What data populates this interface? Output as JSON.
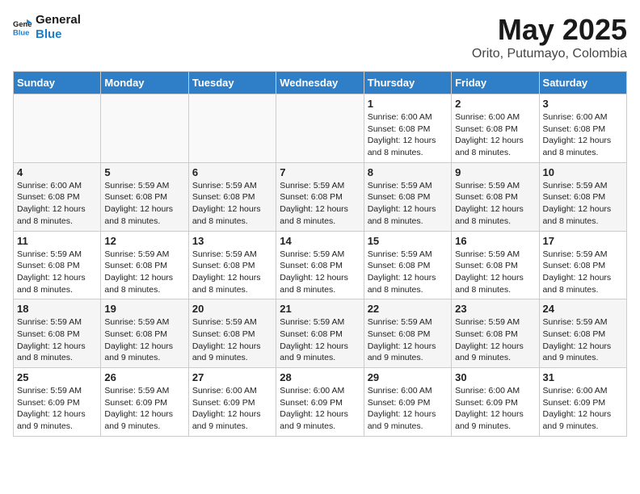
{
  "logo": {
    "line1": "General",
    "line2": "Blue"
  },
  "title": "May 2025",
  "subtitle": "Orito, Putumayo, Colombia",
  "weekdays": [
    "Sunday",
    "Monday",
    "Tuesday",
    "Wednesday",
    "Thursday",
    "Friday",
    "Saturday"
  ],
  "weeks": [
    [
      {
        "day": "",
        "info": ""
      },
      {
        "day": "",
        "info": ""
      },
      {
        "day": "",
        "info": ""
      },
      {
        "day": "",
        "info": ""
      },
      {
        "day": "1",
        "info": "Sunrise: 6:00 AM\nSunset: 6:08 PM\nDaylight: 12 hours and 8 minutes."
      },
      {
        "day": "2",
        "info": "Sunrise: 6:00 AM\nSunset: 6:08 PM\nDaylight: 12 hours and 8 minutes."
      },
      {
        "day": "3",
        "info": "Sunrise: 6:00 AM\nSunset: 6:08 PM\nDaylight: 12 hours and 8 minutes."
      }
    ],
    [
      {
        "day": "4",
        "info": "Sunrise: 6:00 AM\nSunset: 6:08 PM\nDaylight: 12 hours and 8 minutes."
      },
      {
        "day": "5",
        "info": "Sunrise: 5:59 AM\nSunset: 6:08 PM\nDaylight: 12 hours and 8 minutes."
      },
      {
        "day": "6",
        "info": "Sunrise: 5:59 AM\nSunset: 6:08 PM\nDaylight: 12 hours and 8 minutes."
      },
      {
        "day": "7",
        "info": "Sunrise: 5:59 AM\nSunset: 6:08 PM\nDaylight: 12 hours and 8 minutes."
      },
      {
        "day": "8",
        "info": "Sunrise: 5:59 AM\nSunset: 6:08 PM\nDaylight: 12 hours and 8 minutes."
      },
      {
        "day": "9",
        "info": "Sunrise: 5:59 AM\nSunset: 6:08 PM\nDaylight: 12 hours and 8 minutes."
      },
      {
        "day": "10",
        "info": "Sunrise: 5:59 AM\nSunset: 6:08 PM\nDaylight: 12 hours and 8 minutes."
      }
    ],
    [
      {
        "day": "11",
        "info": "Sunrise: 5:59 AM\nSunset: 6:08 PM\nDaylight: 12 hours and 8 minutes."
      },
      {
        "day": "12",
        "info": "Sunrise: 5:59 AM\nSunset: 6:08 PM\nDaylight: 12 hours and 8 minutes."
      },
      {
        "day": "13",
        "info": "Sunrise: 5:59 AM\nSunset: 6:08 PM\nDaylight: 12 hours and 8 minutes."
      },
      {
        "day": "14",
        "info": "Sunrise: 5:59 AM\nSunset: 6:08 PM\nDaylight: 12 hours and 8 minutes."
      },
      {
        "day": "15",
        "info": "Sunrise: 5:59 AM\nSunset: 6:08 PM\nDaylight: 12 hours and 8 minutes."
      },
      {
        "day": "16",
        "info": "Sunrise: 5:59 AM\nSunset: 6:08 PM\nDaylight: 12 hours and 8 minutes."
      },
      {
        "day": "17",
        "info": "Sunrise: 5:59 AM\nSunset: 6:08 PM\nDaylight: 12 hours and 8 minutes."
      }
    ],
    [
      {
        "day": "18",
        "info": "Sunrise: 5:59 AM\nSunset: 6:08 PM\nDaylight: 12 hours and 8 minutes."
      },
      {
        "day": "19",
        "info": "Sunrise: 5:59 AM\nSunset: 6:08 PM\nDaylight: 12 hours and 9 minutes."
      },
      {
        "day": "20",
        "info": "Sunrise: 5:59 AM\nSunset: 6:08 PM\nDaylight: 12 hours and 9 minutes."
      },
      {
        "day": "21",
        "info": "Sunrise: 5:59 AM\nSunset: 6:08 PM\nDaylight: 12 hours and 9 minutes."
      },
      {
        "day": "22",
        "info": "Sunrise: 5:59 AM\nSunset: 6:08 PM\nDaylight: 12 hours and 9 minutes."
      },
      {
        "day": "23",
        "info": "Sunrise: 5:59 AM\nSunset: 6:08 PM\nDaylight: 12 hours and 9 minutes."
      },
      {
        "day": "24",
        "info": "Sunrise: 5:59 AM\nSunset: 6:08 PM\nDaylight: 12 hours and 9 minutes."
      }
    ],
    [
      {
        "day": "25",
        "info": "Sunrise: 5:59 AM\nSunset: 6:09 PM\nDaylight: 12 hours and 9 minutes."
      },
      {
        "day": "26",
        "info": "Sunrise: 5:59 AM\nSunset: 6:09 PM\nDaylight: 12 hours and 9 minutes."
      },
      {
        "day": "27",
        "info": "Sunrise: 6:00 AM\nSunset: 6:09 PM\nDaylight: 12 hours and 9 minutes."
      },
      {
        "day": "28",
        "info": "Sunrise: 6:00 AM\nSunset: 6:09 PM\nDaylight: 12 hours and 9 minutes."
      },
      {
        "day": "29",
        "info": "Sunrise: 6:00 AM\nSunset: 6:09 PM\nDaylight: 12 hours and 9 minutes."
      },
      {
        "day": "30",
        "info": "Sunrise: 6:00 AM\nSunset: 6:09 PM\nDaylight: 12 hours and 9 minutes."
      },
      {
        "day": "31",
        "info": "Sunrise: 6:00 AM\nSunset: 6:09 PM\nDaylight: 12 hours and 9 minutes."
      }
    ]
  ]
}
